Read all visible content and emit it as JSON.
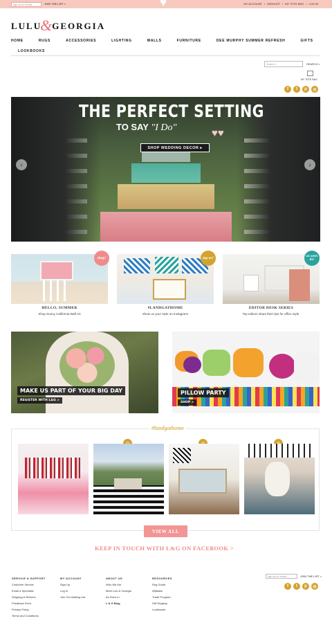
{
  "topbar": {
    "signup_placeholder": "sign up for emails",
    "join_label": "JOIN THE LIST >",
    "links": [
      "MY ACCOUNT",
      "/",
      "WISHLIST",
      "/",
      "MY TOTE BAG",
      "/",
      "LOG IN"
    ]
  },
  "logo": {
    "left": "LULU",
    "amp": "&",
    "right": "GEORGIA"
  },
  "nav": {
    "items": [
      "HOME",
      "RUGS",
      "ACCESSORIES",
      "LIGHTING",
      "WALLS",
      "FURNITURE",
      "DEE MURPHY SUMMER REFRESH",
      "GIFTS"
    ],
    "second_row": "LOOKBOOKS"
  },
  "search": {
    "placeholder": "Search...",
    "button": "SEARCH >"
  },
  "tote": {
    "label": "MY TOTE BAG"
  },
  "social_icons": [
    "facebook-icon",
    "twitter-icon",
    "pinterest-icon",
    "instagram-icon"
  ],
  "hero": {
    "line1": "THE PERFECT SETTING",
    "line2_prefix": "TO SAY ",
    "line2_script": "\"I Do\"",
    "button": "SHOP WEDDING DECOR ▸",
    "prev": "‹",
    "next": "›"
  },
  "tiles": [
    {
      "badge": "shop!",
      "title": "HELLO, SUMMER",
      "sub": "Shop Sunny California Wall Art",
      "badge_color": "#ef8c8a"
    },
    {
      "badge": "tag us!",
      "title": "#LANDGATHOME",
      "sub": "Show us your style on Instagram!",
      "badge_color": "#d4a22f"
    },
    {
      "badge": "as seen in!",
      "title": "EDITOR DESK SERIES",
      "sub": "Top editors share their tips for office style.",
      "badge_color": "#2aa39c"
    }
  ],
  "promos": {
    "wedding": {
      "headline": "MAKE US PART OF YOUR BIG DAY",
      "sub": "REGISTER WITH L&G >"
    },
    "pillow": {
      "headline": "PILLOW PARTY",
      "sub": "SHOP >"
    }
  },
  "instagram": {
    "title": "#landgathome",
    "view_all": "VIEW ALL"
  },
  "facebook_cta": "KEEP IN TOUCH WITH L&G ON FACEBOOK >",
  "footer": {
    "columns": [
      {
        "heading": "SERVICE & SUPPORT",
        "links": [
          "Customer Service",
          "Email a Specialist",
          "Shipping & Returns",
          "Feedback Form",
          "Privacy Policy",
          "Terms and Conditions"
        ]
      },
      {
        "heading": "MY ACCOUNT",
        "links": [
          "Sign Up",
          "Log In",
          "Join Our Mailing List"
        ]
      },
      {
        "heading": "ABOUT US",
        "links": [
          "Who We Are",
          "Meet Lulu & Georgia",
          "As Seen In",
          "L & G Blog"
        ]
      },
      {
        "heading": "RESOURCES",
        "links": [
          "Rug Guide",
          "Affiliates",
          "Trade Program",
          "Gift Registry",
          "Lookbooks"
        ]
      }
    ],
    "signup_placeholder": "sign up for emails",
    "join_label": "JOIN THE LIST >"
  }
}
